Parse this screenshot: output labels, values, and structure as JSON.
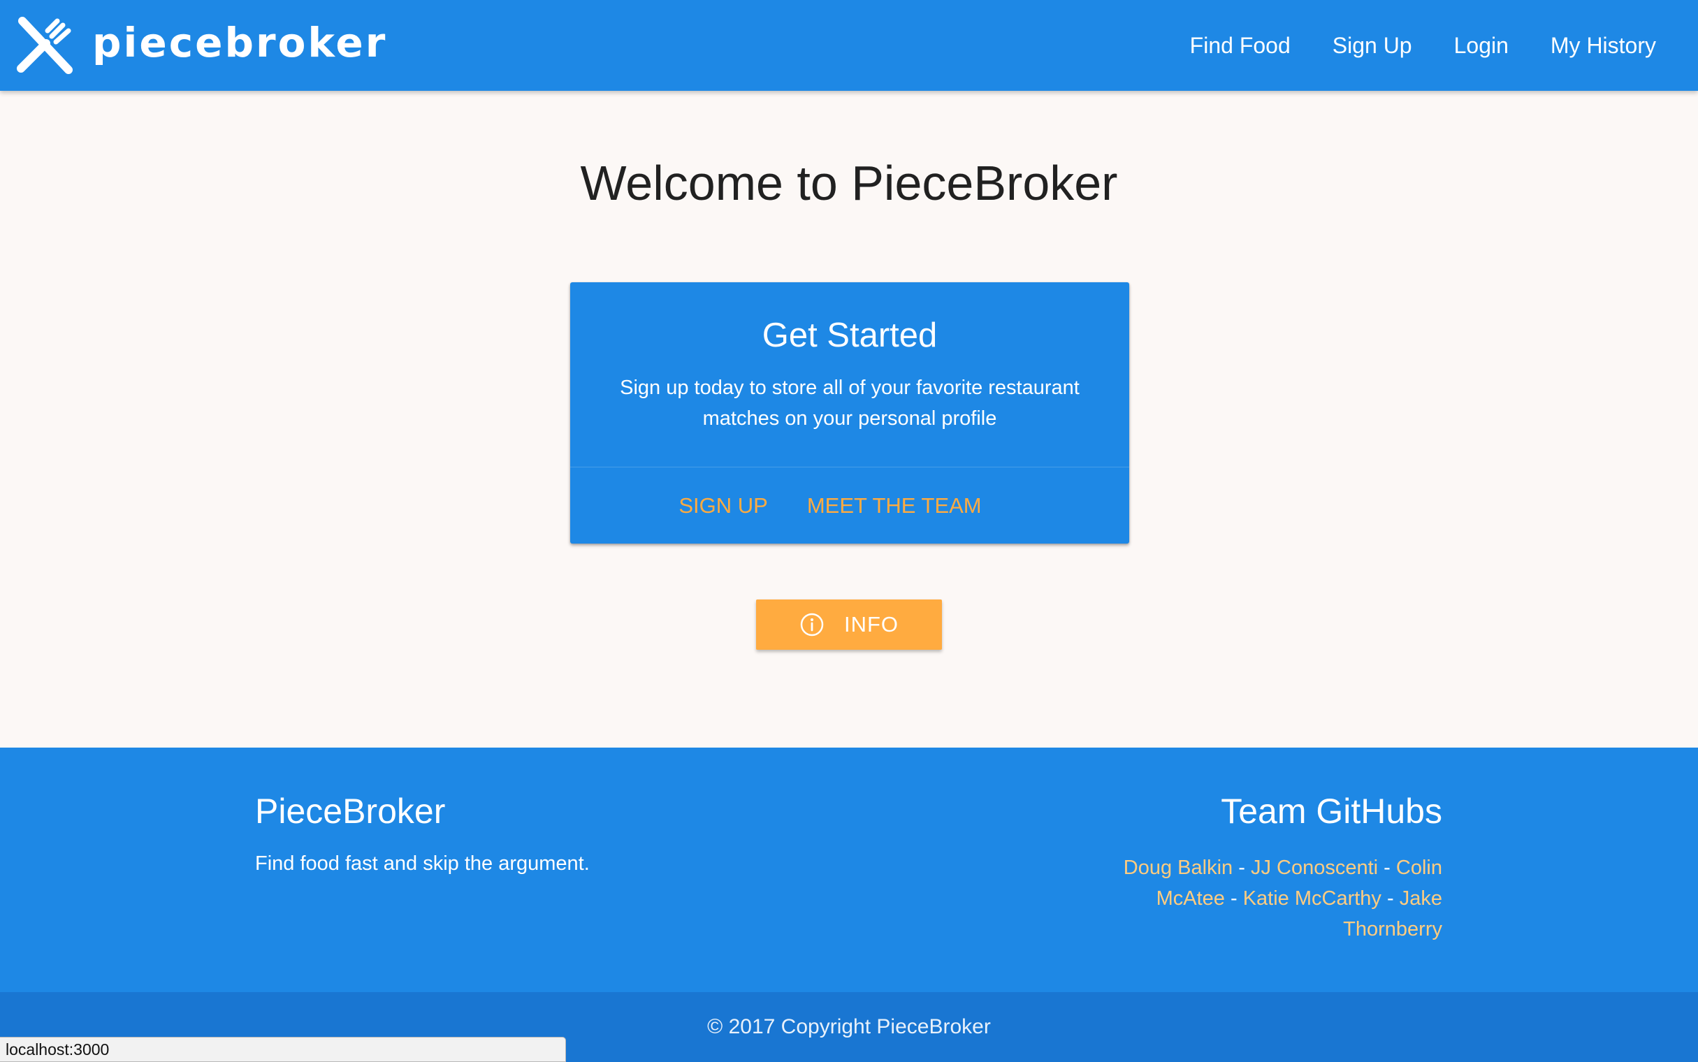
{
  "navbar": {
    "brand_name": "piecebroker",
    "links": [
      {
        "label": "Find Food"
      },
      {
        "label": "Sign Up"
      },
      {
        "label": "Login"
      },
      {
        "label": "My History"
      }
    ]
  },
  "main": {
    "heading": "Welcome to PieceBroker",
    "card": {
      "title": "Get Started",
      "text": "Sign up today to store all of your favorite restaurant matches on your personal profile",
      "actions": [
        {
          "label": "Sign Up"
        },
        {
          "label": "Meet the Team"
        }
      ]
    },
    "info_button": {
      "label": "INFO",
      "icon": "info-circle-icon"
    }
  },
  "footer": {
    "title": "PieceBroker",
    "tagline": "Find food fast and skip the argument.",
    "team_title": "Team GitHubs",
    "team_members": [
      {
        "name": "Doug Balkin"
      },
      {
        "name": "JJ Conoscenti"
      },
      {
        "name": "Colin McAtee"
      },
      {
        "name": "Katie McCarthy"
      },
      {
        "name": "Jake Thornberry"
      }
    ],
    "separator": "-",
    "copyright": "© 2017 Copyright PieceBroker"
  },
  "status_bar": {
    "url": "localhost:3000"
  },
  "colors": {
    "primary": "#1e88e5",
    "primary_dark": "#1976d2",
    "accent": "#ffab40",
    "accent_light": "#ffcc80",
    "background": "#fcf8f6"
  }
}
